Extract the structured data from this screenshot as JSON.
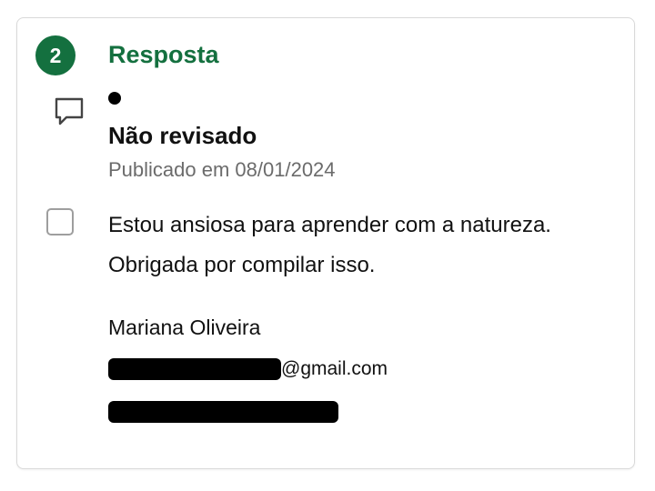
{
  "step": {
    "number": "2",
    "title": "Resposta"
  },
  "comment": {
    "status": "Não revisado",
    "published": "Publicado em 08/01/2024",
    "message_lines": [
      "Estou ansiosa para aprender com a natureza.",
      "Obrigada por compilar isso."
    ]
  },
  "author": {
    "name": "Mariana Oliveira",
    "email_domain": "@gmail.com"
  },
  "colors": {
    "accent": "#14703f",
    "muted_text": "#6b6b6b",
    "redaction": "#000000"
  },
  "icons": {
    "comment": "speech-bubble-icon",
    "checkbox": "checkbox-unchecked"
  }
}
